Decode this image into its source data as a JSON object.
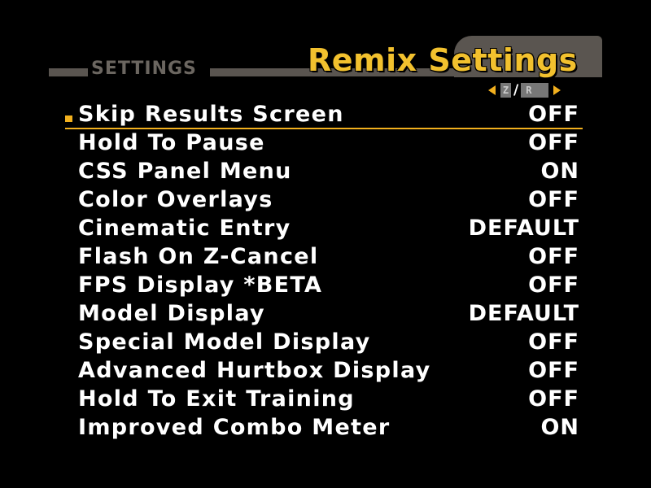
{
  "header": {
    "section_label": "SETTINGS",
    "title": "Remix Settings"
  },
  "pager": {
    "left_key": "Z",
    "separator": "/",
    "right_key": "R"
  },
  "colors": {
    "accent": "#f2c12e",
    "bar": "#5a5550",
    "text": "#ffffff",
    "background": "#000000"
  },
  "settings": [
    {
      "label": "Skip Results Screen",
      "value": "OFF"
    },
    {
      "label": "Hold To Pause",
      "value": "OFF"
    },
    {
      "label": "CSS Panel Menu",
      "value": "ON"
    },
    {
      "label": "Color Overlays",
      "value": "OFF"
    },
    {
      "label": "Cinematic Entry",
      "value": "DEFAULT"
    },
    {
      "label": "Flash On Z-Cancel",
      "value": "OFF"
    },
    {
      "label": "FPS Display *BETA",
      "value": "OFF"
    },
    {
      "label": "Model Display",
      "value": "DEFAULT"
    },
    {
      "label": "Special Model Display",
      "value": "OFF"
    },
    {
      "label": "Advanced Hurtbox Display",
      "value": "OFF"
    },
    {
      "label": "Hold To Exit Training",
      "value": "OFF"
    },
    {
      "label": "Improved Combo Meter",
      "value": "ON"
    }
  ],
  "selected_index": 0
}
